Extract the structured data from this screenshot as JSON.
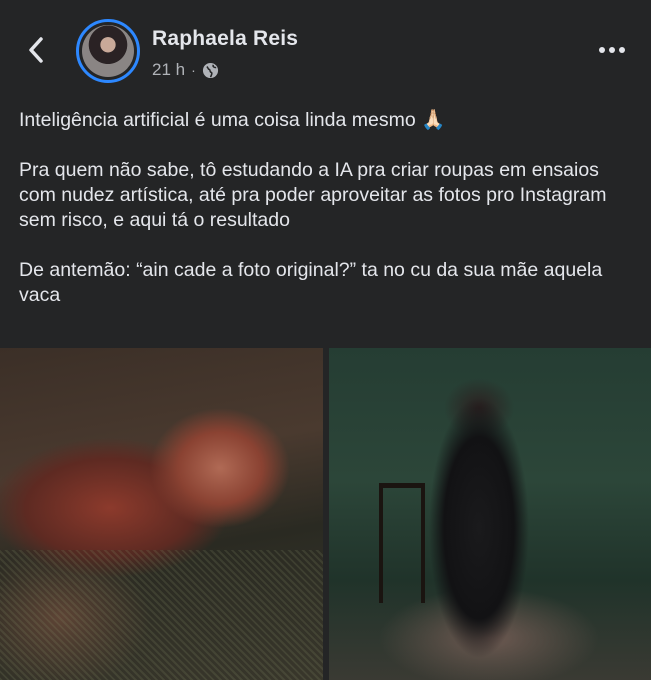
{
  "header": {
    "author_name": "Raphaela Reis",
    "timestamp": "21 h",
    "separator": "·",
    "privacy_icon": "globe-icon",
    "back_icon": "chevron-left-icon",
    "more_icon": "more-horizontal-icon",
    "avatar_ring_color": "#2d88ff"
  },
  "post": {
    "paragraphs": [
      "Inteligência artificial é uma coisa linda mesmo 🙏🏻",
      "Pra quem não sabe, tô estudando a IA pra criar roupas em ensaios com nudez artística, até pra poder aproveitar as fotos pro Instagram sem risco, e aqui tá o resultado",
      "De antemão: “ain cade a foto original?” ta no cu da sua mãe aquela vaca"
    ]
  },
  "photos": {
    "count": 2
  },
  "colors": {
    "background": "#242526",
    "text_primary": "#e4e6eb",
    "text_secondary": "#b0b3b8"
  }
}
